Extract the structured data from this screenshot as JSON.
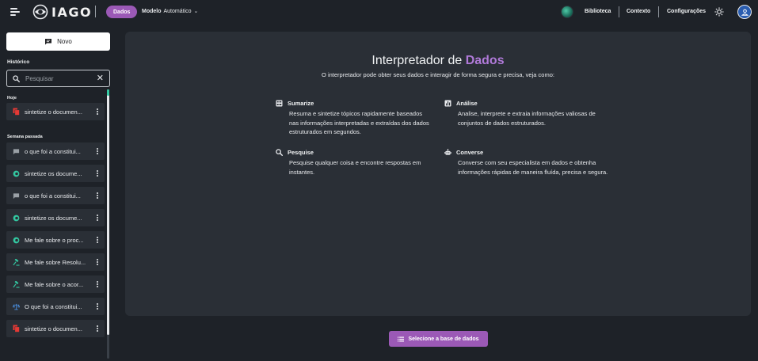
{
  "header": {
    "logo_text": "IAGO",
    "mode_pill": "Dados",
    "model_label": "Modelo",
    "model_value": "Automático",
    "nav": [
      "Biblioteca",
      "Contexto",
      "Configurações"
    ]
  },
  "sidebar": {
    "new_button": "Novo",
    "history_title": "Histórico",
    "search_placeholder": "Pesquisar",
    "groups": [
      {
        "label": "Hoje",
        "items": [
          {
            "icon": "document-stack-icon",
            "color": "#e53935",
            "text": "sintetize o documen..."
          }
        ]
      },
      {
        "label": "Semana passada",
        "items": [
          {
            "icon": "chat-icon",
            "color": "#9aa0a6",
            "text": "o que foi a constitui..."
          },
          {
            "icon": "ai-logo-icon",
            "color": "#33c9a2",
            "text": "sintetize os docume..."
          },
          {
            "icon": "chat-icon",
            "color": "#9aa0a6",
            "text": "o que foi a constitui..."
          },
          {
            "icon": "ai-logo-icon",
            "color": "#33c9a2",
            "text": "sintetize os docume..."
          },
          {
            "icon": "ai-logo-icon",
            "color": "#33c9a2",
            "text": "Me fale sobre o proc..."
          },
          {
            "icon": "gavel-icon",
            "color": "#33c9a2",
            "text": "Me fale sobre Resolu..."
          },
          {
            "icon": "gavel-icon",
            "color": "#33c9a2",
            "text": "Me fale sobre o acor..."
          },
          {
            "icon": "scales-icon",
            "color": "#4a90e2",
            "text": "O que foi a constitui..."
          },
          {
            "icon": "document-stack-icon",
            "color": "#e53935",
            "text": "sintetize o documen..."
          }
        ]
      }
    ]
  },
  "main": {
    "title_prefix": "Interpretador de ",
    "title_highlight": "Dados",
    "subtitle": "O interpretador pode obter seus dados e interagir de forma segura e precisa, veja como:",
    "features": [
      {
        "icon": "summary-icon",
        "title": "Sumarize",
        "desc": "Resuma e sintetize tópicos rapidamente baseados nas informações interpretadas e extraídas dos dados estruturados em segundos."
      },
      {
        "icon": "bar-chart-icon",
        "title": "Análise",
        "desc": "Analise, interprete e extraia informações valiosas de conjuntos de dados estruturados."
      },
      {
        "icon": "search-icon",
        "title": "Pesquise",
        "desc": "Pesquise qualquer coisa e encontre respostas em instantes."
      },
      {
        "icon": "robot-icon",
        "title": "Converse",
        "desc": "Converse com seu especialista em dados e obtenha informações rápidas de maneira fluída, precisa e segura."
      }
    ],
    "cta": "Selecione a base de dados"
  },
  "colors": {
    "accent": "#9b59b6",
    "accent_text": "#b07ad9",
    "panel": "#2a2f36",
    "background": "#1e2228"
  }
}
